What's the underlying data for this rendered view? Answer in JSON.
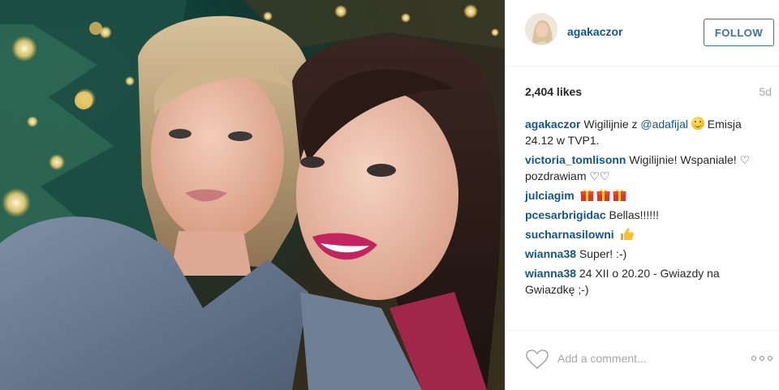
{
  "post": {
    "image_alt": "Two women taking a selfie in front of a Christmas tree",
    "author": "agakaczor",
    "follow_label": "FOLLOW",
    "likes": "2,404 likes",
    "time": "5d"
  },
  "comments": [
    {
      "author": "agakaczor",
      "parts": [
        "Wigilijnie z ",
        "@adafijal",
        " ",
        " Emisja 24.12 w TVP1."
      ]
    },
    {
      "author": "victoria_tomlisonn",
      "text": "Wigilijnie! Wspaniale! ♡ pozdrawiam ♡♡"
    },
    {
      "author": "julciagim",
      "text": ""
    },
    {
      "author": "pcesarbrigidac",
      "text": "Bellas!!!!!!"
    },
    {
      "author": "sucharnasilowni",
      "text": ""
    },
    {
      "author": "wianna38",
      "text": "Super! :-)"
    },
    {
      "author": "wianna38",
      "text": "24 XII o 20.20 - Gwiazdy na Gwiazdkę ;-)"
    }
  ],
  "footer": {
    "comment_placeholder": "Add a comment..."
  },
  "icons": {
    "heart": "heart-icon",
    "more": "more-options-icon",
    "smile": "smiling-face-emoji",
    "gift": "gift-emoji",
    "thumbs": "thumbs-up-emoji"
  },
  "colors": {
    "link": "#125688",
    "follow": "#3f729b",
    "muted": "#a5a7aa",
    "text": "#262626"
  }
}
